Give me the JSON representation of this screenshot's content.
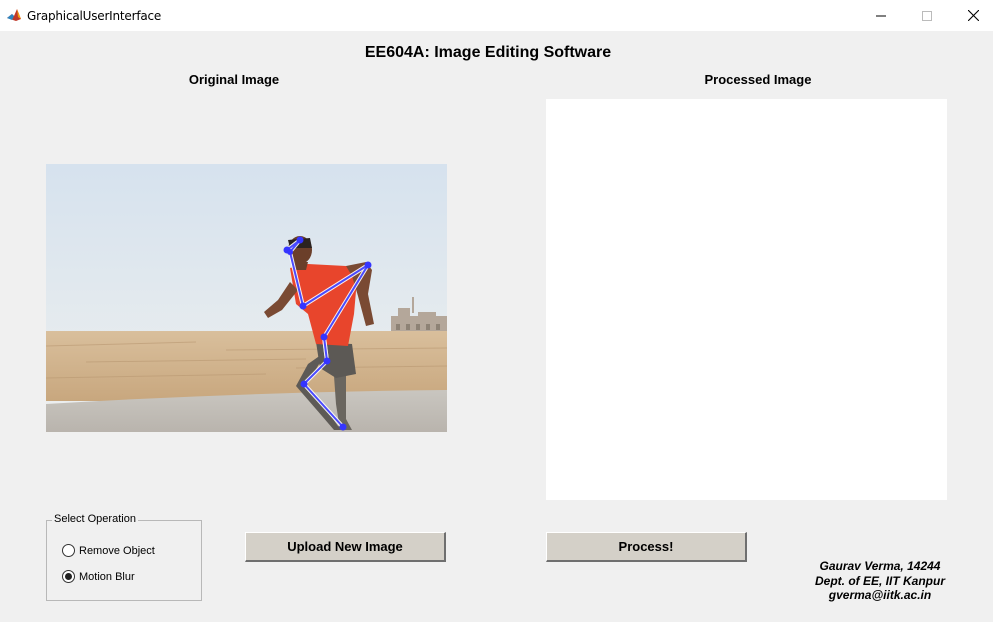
{
  "window": {
    "title": "GraphicalUserInterface",
    "icon": "matlab-icon"
  },
  "app": {
    "main_title": "EE604A: Image Editing Software"
  },
  "panels": {
    "original_title": "Original Image",
    "processed_title": "Processed Image"
  },
  "operation": {
    "group_label": "Select Operation",
    "options": [
      {
        "label": "Remove Object",
        "selected": false
      },
      {
        "label": "Motion Blur",
        "selected": true
      }
    ]
  },
  "buttons": {
    "upload_label": "Upload New Image",
    "process_label": "Process!"
  },
  "credits": {
    "line1": "Gaurav Verma, 14244",
    "line2": "Dept. of EE, IIT Kanpur",
    "line3": "gverma@iitk.ac.in"
  },
  "colors": {
    "background": "#f0f0f0",
    "button_face": "#d4d0c8",
    "skeleton": "#4a4aff",
    "shirt": "#e8452c"
  }
}
